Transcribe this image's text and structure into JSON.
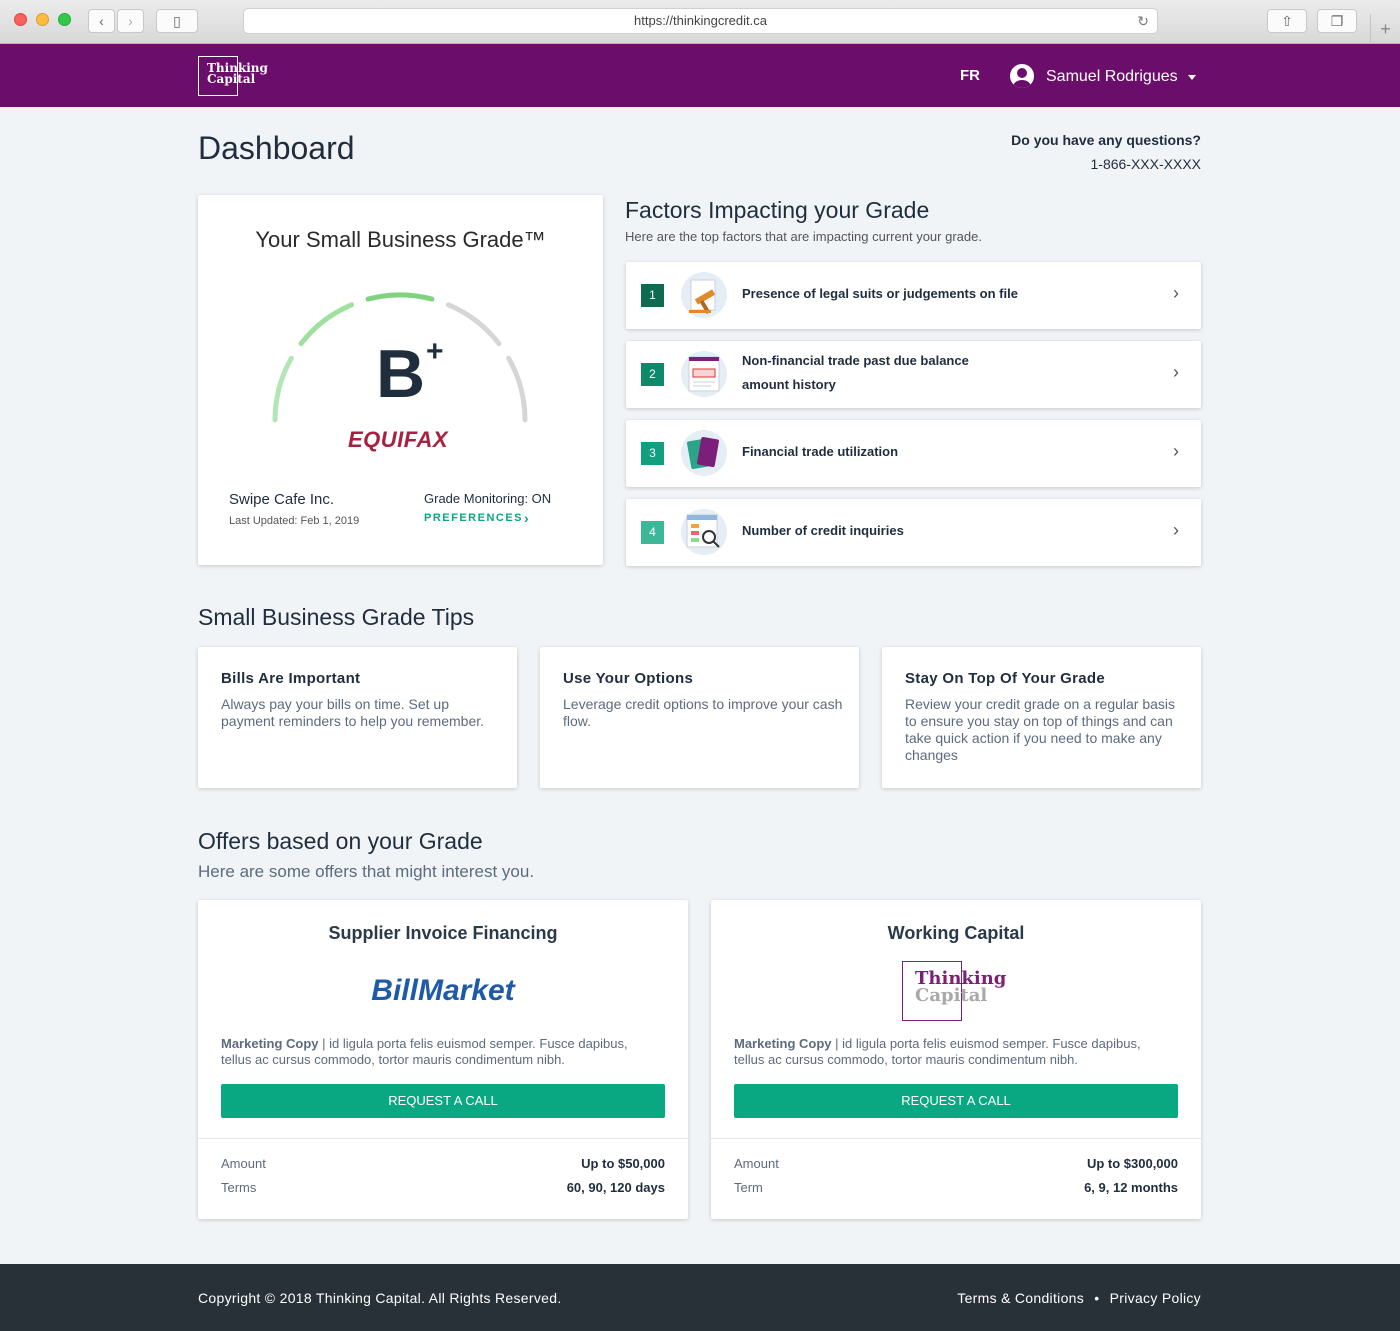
{
  "browser": {
    "url": "https://thinkingcredit.ca"
  },
  "header": {
    "logo_line1": "Thinking",
    "logo_line2": "Capital",
    "lang": "FR",
    "user_name": "Samuel Rodrigues"
  },
  "page": {
    "title": "Dashboard",
    "questions_label": "Do you have any questions?",
    "phone": "1-866-XXX-XXXX"
  },
  "grade": {
    "title": "Your Small Business Grade™",
    "letter": "B",
    "modifier": "+",
    "bureau": "EQUIFAX",
    "business_name": "Swipe Cafe Inc.",
    "last_updated": "Last Updated: Feb 1, 2019",
    "monitoring": "Grade Monitoring: ON",
    "preferences": "PREFERENCES"
  },
  "factors": {
    "title": "Factors Impacting your Grade",
    "subtitle": "Here are the top factors that are impacting current your grade.",
    "items": [
      {
        "num": "1",
        "line1": "Presence of legal suits or judgements on file",
        "line2": "",
        "icon": "gavel-icon",
        "color": "#0e6b4f"
      },
      {
        "num": "2",
        "line1": "Non-financial trade past due balance",
        "line2": "amount history",
        "icon": "overdue-invoice-icon",
        "color": "#0e8a6a"
      },
      {
        "num": "3",
        "line1": "Financial trade utilization",
        "line2": "",
        "icon": "credit-cards-icon",
        "color": "#10a080"
      },
      {
        "num": "4",
        "line1": "Number of credit inquiries",
        "line2": "",
        "icon": "credit-report-magnifier-icon",
        "color": "#3cb898"
      }
    ]
  },
  "tips": {
    "title": "Small Business Grade Tips",
    "items": [
      {
        "heading": "Bills Are Important",
        "body": "Always pay your bills on time. Set up payment reminders to help you remember."
      },
      {
        "heading": "Use Your Options",
        "body": "Leverage credit options to improve your cash flow."
      },
      {
        "heading": "Stay On Top Of Your Grade",
        "body": "Review your credit grade on a regular basis to ensure you stay on top of things and can take quick action if you need to make any changes"
      }
    ]
  },
  "offers": {
    "title": "Offers based on your Grade",
    "subtitle": "Here are some offers that might interest you.",
    "items": [
      {
        "heading": "Supplier Invoice Financing",
        "brand": "BillMarket",
        "copy_bold": "Marketing Copy",
        "copy": " | id ligula porta felis euismod semper. Fusce dapibus, tellus ac cursus commodo, tortor mauris condimentum nibh.",
        "button": "REQUEST A CALL",
        "amount_label": "Amount",
        "amount": "Up to $50,000",
        "terms_label": "Terms",
        "terms": "60, 90, 120 days"
      },
      {
        "heading": "Working Capital",
        "brand_line1": "Thinking",
        "brand_line2": "Capital",
        "copy_bold": "Marketing Copy",
        "copy": " | id ligula porta felis euismod semper. Fusce dapibus, tellus ac cursus commodo, tortor mauris condimentum nibh.",
        "button": "REQUEST A CALL",
        "amount_label": "Amount",
        "amount": "Up to $300,000",
        "terms_label": "Term",
        "terms": "6, 9, 12 months"
      }
    ]
  },
  "footer": {
    "copyright": "Copyright © 2018 Thinking Capital. All Rights Reserved.",
    "terms": "Terms & Conditions",
    "separator": "•",
    "privacy": "Privacy Policy"
  },
  "colors": {
    "brand": "#6b0e6b",
    "accent": "#0aa882",
    "gauge_active": "#8fd98f",
    "gauge_inactive": "#d6d6d6"
  }
}
